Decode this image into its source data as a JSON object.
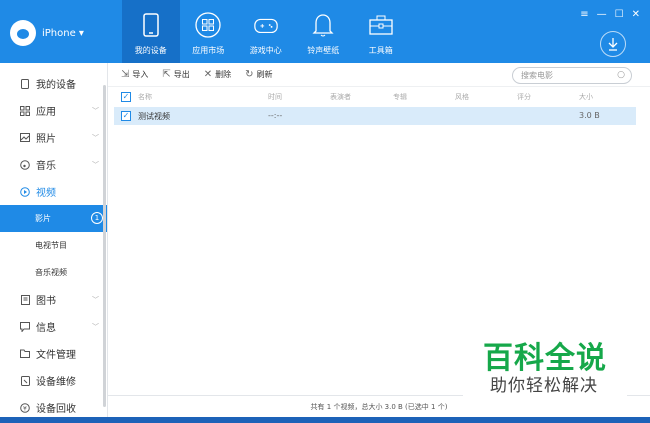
{
  "device": {
    "name": "iPhone ▾"
  },
  "nav": [
    {
      "label": "我的设备",
      "icon": "phone-icon"
    },
    {
      "label": "应用市场",
      "icon": "apps-icon"
    },
    {
      "label": "游戏中心",
      "icon": "gamepad-icon"
    },
    {
      "label": "铃声壁纸",
      "icon": "bell-icon"
    },
    {
      "label": "工具箱",
      "icon": "toolbox-icon"
    }
  ],
  "window_controls": {
    "menu": "≡",
    "minimize": "—",
    "maximize": "☐",
    "close": "✕"
  },
  "sidebar": {
    "items": [
      {
        "label": "我的设备",
        "icon": "device-icon"
      },
      {
        "label": "应用",
        "icon": "apps-grid-icon"
      },
      {
        "label": "照片",
        "icon": "photo-icon"
      },
      {
        "label": "音乐",
        "icon": "music-icon"
      },
      {
        "label": "视频",
        "icon": "video-icon"
      },
      {
        "label": "影片",
        "badge": "1"
      },
      {
        "label": "电视节目"
      },
      {
        "label": "音乐视频"
      },
      {
        "label": "图书",
        "icon": "book-icon"
      },
      {
        "label": "信息",
        "icon": "message-icon"
      },
      {
        "label": "文件管理",
        "icon": "folder-icon"
      },
      {
        "label": "设备维修",
        "icon": "repair-icon"
      },
      {
        "label": "设备回收",
        "icon": "recycle-icon"
      }
    ]
  },
  "toolbar": {
    "import": "导入",
    "export": "导出",
    "delete": "删除",
    "refresh": "刷新",
    "search_placeholder": "搜索电影"
  },
  "table": {
    "columns": [
      "名称",
      "时间",
      "表演者",
      "专辑",
      "风格",
      "评分",
      "大小"
    ],
    "rows": [
      {
        "name": "测试视频",
        "time": "--:--",
        "size": "3.0 B"
      }
    ]
  },
  "footer": {
    "status": "共有 1 个视频，总大小 3.0 B (已选中 1 个)"
  },
  "watermark": {
    "title": "百科全说",
    "subtitle": "助你轻松解决"
  },
  "colors": {
    "accent": "#1f8ae6",
    "row_selected": "#d9ebfa",
    "watermark_green": "#16a84a"
  }
}
